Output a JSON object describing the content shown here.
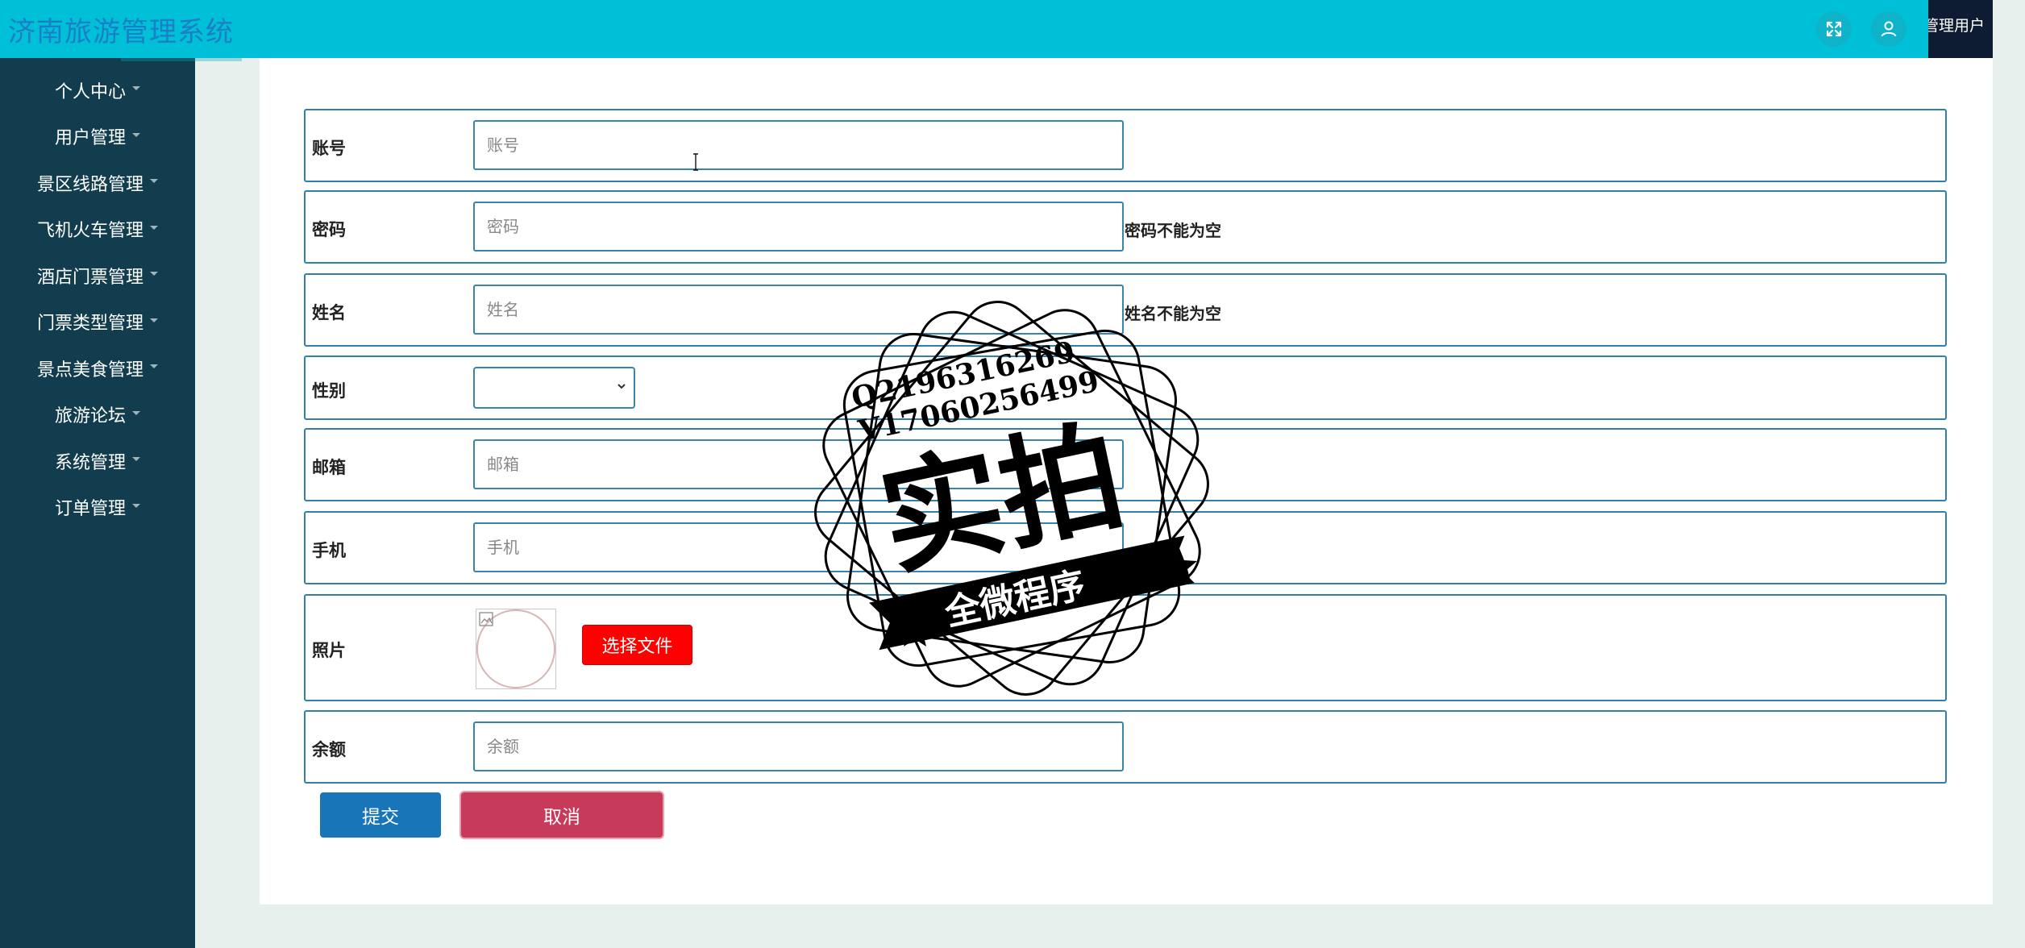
{
  "header": {
    "title": "济南旅游管理系统",
    "user_label": "管理用户",
    "icons": [
      "fullscreen-icon",
      "user-icon"
    ]
  },
  "sidebar": {
    "items": [
      {
        "label": "个人中心"
      },
      {
        "label": "用户管理"
      },
      {
        "label": "景区线路管理"
      },
      {
        "label": "飞机火车管理"
      },
      {
        "label": "酒店门票管理"
      },
      {
        "label": "门票类型管理"
      },
      {
        "label": "景点美食管理"
      },
      {
        "label": "旅游论坛"
      },
      {
        "label": "系统管理"
      },
      {
        "label": "订单管理"
      }
    ]
  },
  "form": {
    "account": {
      "label": "账号",
      "placeholder": "账号",
      "value": ""
    },
    "password": {
      "label": "密码",
      "placeholder": "密码",
      "value": "",
      "error": "密码不能为空"
    },
    "name": {
      "label": "姓名",
      "placeholder": "姓名",
      "value": "",
      "error": "姓名不能为空"
    },
    "gender": {
      "label": "性别",
      "selected": ""
    },
    "email": {
      "label": "邮箱",
      "placeholder": "邮箱",
      "value": ""
    },
    "phone": {
      "label": "手机",
      "placeholder": "手机",
      "value": ""
    },
    "photo": {
      "label": "照片",
      "button_label": "选择文件"
    },
    "balance": {
      "label": "余额",
      "placeholder": "余额",
      "value": ""
    }
  },
  "actions": {
    "submit_label": "提交",
    "cancel_label": "取消"
  },
  "watermark": {
    "line1": "Q2196316269",
    "line2": "V17060256499",
    "main": "实拍",
    "banner": "全微程序"
  },
  "colors": {
    "topbar": "#00c0d8",
    "sidebar": "#123d4e",
    "submit": "#1876b8",
    "cancel": "#c73a5a",
    "file_button": "#ff0000"
  }
}
